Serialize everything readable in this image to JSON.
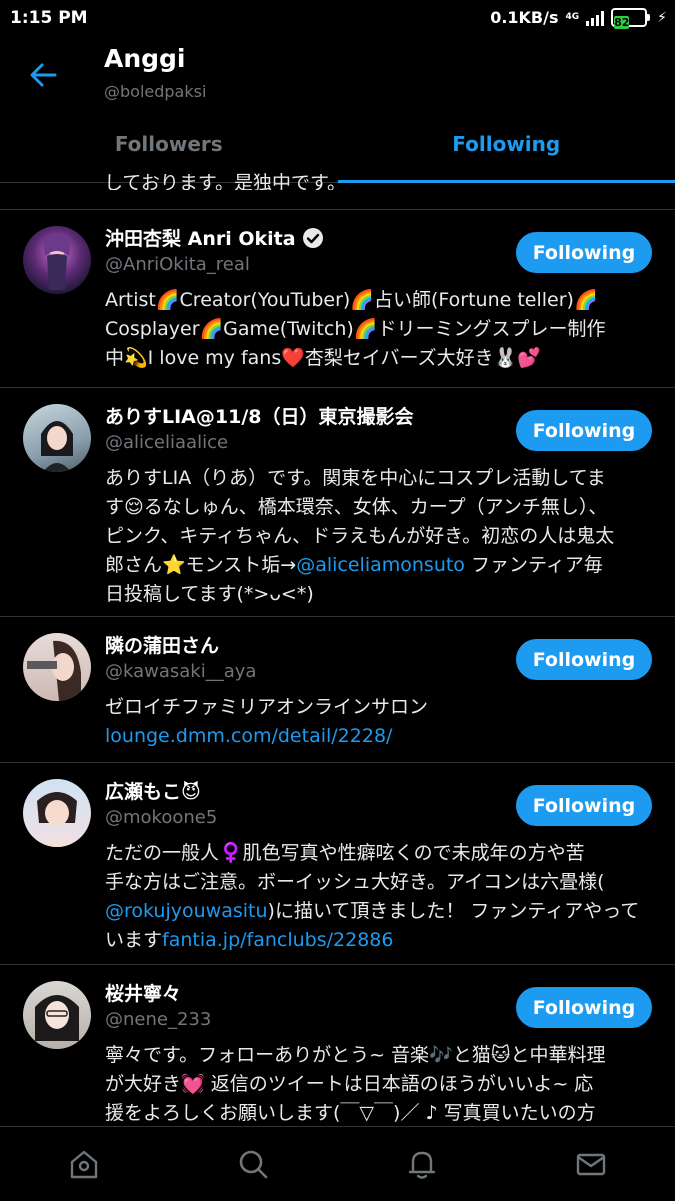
{
  "status_bar": {
    "time": "1:15 PM",
    "speed": "0.1KB/s",
    "network": "4G",
    "battery": "82"
  },
  "header": {
    "name": "Anggi",
    "handle": "@boledpaksi"
  },
  "tabs": [
    {
      "label": "Followers",
      "active": false
    },
    {
      "label": "Following",
      "active": true
    }
  ],
  "cutoff_text": "しております。是独中です。",
  "button_label": "Following",
  "colors": {
    "accent": "#1d9bf0",
    "background": "#000000",
    "secondary_text": "#71767b",
    "divider": "#2f3336"
  },
  "users": [
    {
      "name": "沖田杏梨 Anri Okita",
      "handle": "@AnriOkita_real",
      "verified": true,
      "bio_lines": [
        "Artist🌈Creator(YouTuber)🌈占い師(Fortune teller)🌈",
        "Cosplayer🌈Game(Twitch)🌈ドリーミングスプレー制作",
        "中💫I love my fans❤️杏梨セイバーズ大好き🐰💕"
      ]
    },
    {
      "name": "ありすLIA@11/8（日）東京撮影会",
      "handle": "@aliceliaalice",
      "bio_lines": [
        "ありすLIA（りあ）です。関東を中心にコスプレ活動してま",
        "す😌るなしゅん、橋本環奈、女体、カープ（アンチ無し）、",
        "ピンク、キティちゃん、ドラえもんが好き。初恋の人は鬼太",
        "日投稿してます(*>ᴗ<*)"
      ],
      "bio_line4_pre": "郎さん⭐モンスト垢→",
      "bio_line4_link": "@aliceliamonsuto",
      "bio_line4_post": " ファンティア毎"
    },
    {
      "name": "隣の蒲田さん",
      "handle": "@kawasaki__aya",
      "bio_lines": [
        "ゼロイチファミリアオンラインサロン"
      ],
      "bio_link": "lounge.dmm.com/detail/2228/"
    },
    {
      "name": "広瀬もこ😈",
      "handle": "@mokoone5",
      "bio_lines": [
        "ただの一般人♀️肌色写真や性癖呟くので未成年の方や苦",
        "手な方はご注意。ボーイッシュ大好き。アイコンは六畳様("
      ],
      "bio_line3_link": "@rokujyouwasitu",
      "bio_line3_text": ")に描いて頂きました！ ファンティアやって",
      "bio_line4_text": "います",
      "bio_line4_link": "fantia.jp/fanclubs/22886"
    },
    {
      "name": "桜井寧々",
      "handle": "@nene_233",
      "bio_lines": [
        "寧々です。フォローありがとう~ 音楽🎶と猫🐱と中華料理",
        "が大好き💓 返信のツイートは日本語のほうがいいよ~ 応",
        "援をよろしくお願いします(￣▽￣)／ ♪ 写真買いたいの方"
      ]
    }
  ],
  "bottom_nav": [
    {
      "icon": "home-icon"
    },
    {
      "icon": "search-icon"
    },
    {
      "icon": "bell-icon"
    },
    {
      "icon": "mail-icon"
    }
  ]
}
